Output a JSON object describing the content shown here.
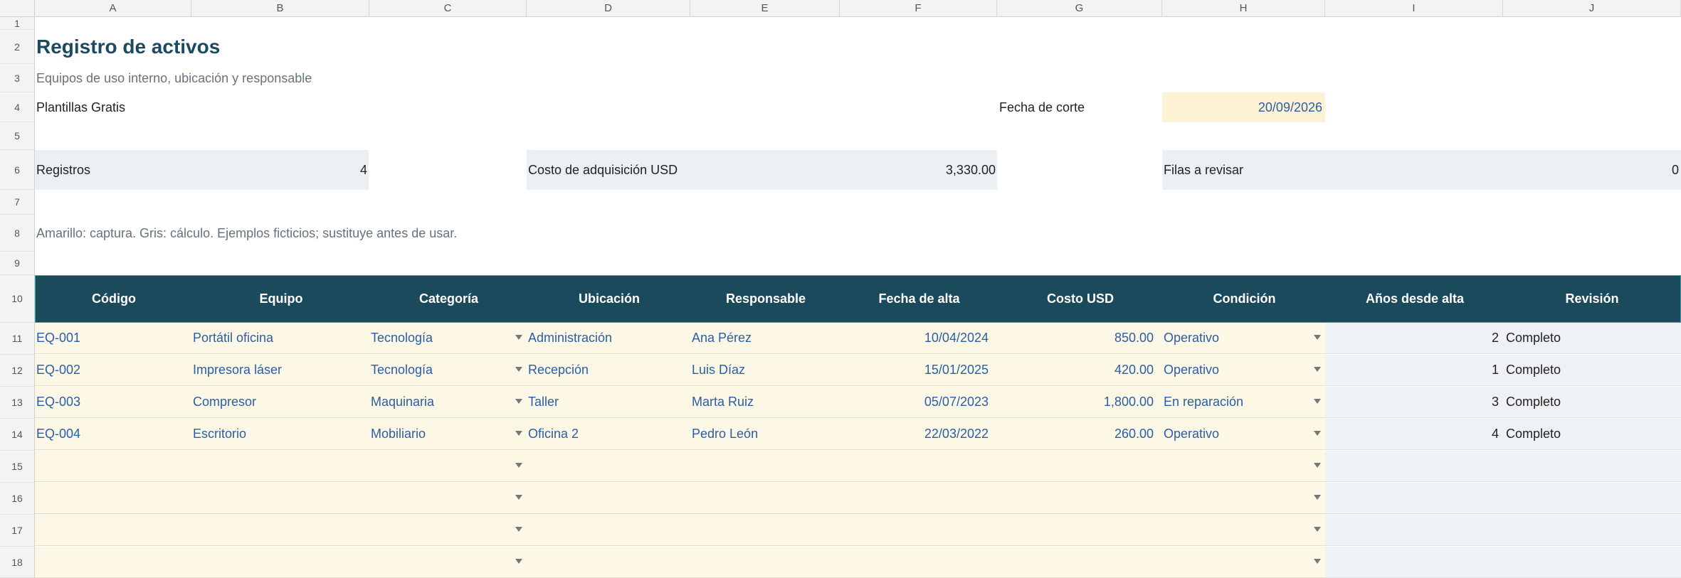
{
  "columns": [
    "A",
    "B",
    "C",
    "D",
    "E",
    "F",
    "G",
    "H",
    "I",
    "J"
  ],
  "row_numbers": [
    "1",
    "2",
    "3",
    "4",
    "5",
    "6",
    "7",
    "8",
    "9",
    "10",
    "11",
    "12",
    "13",
    "14",
    "15",
    "16",
    "17",
    "18"
  ],
  "title": "Registro de activos",
  "subtitle": "Equipos de uso interno, ubicación y responsable",
  "brand": "Plantillas Gratis",
  "cutoff_label": "Fecha de corte",
  "cutoff_date": "20/09/2026",
  "kpis": {
    "records_label": "Registros",
    "records_value": "4",
    "cost_label": "Costo de adquisición USD",
    "cost_value": "3,330.00",
    "review_label": "Filas a revisar",
    "review_value": "0"
  },
  "note": "Amarillo: captura. Gris: cálculo. Ejemplos ficticios; sustituye antes de usar.",
  "table_headers": [
    "Código",
    "Equipo",
    "Categoría",
    "Ubicación",
    "Responsable",
    "Fecha de alta",
    "Costo USD",
    "Condición",
    "Años desde alta",
    "Revisión"
  ],
  "table_rows": [
    [
      "EQ-001",
      "Portátil oficina",
      "Tecnología",
      "Administración",
      "Ana Pérez",
      "10/04/2024",
      "850.00",
      "Operativo",
      "2",
      "Completo"
    ],
    [
      "EQ-002",
      "Impresora láser",
      "Tecnología",
      "Recepción",
      "Luis Díaz",
      "15/01/2025",
      "420.00",
      "Operativo",
      "1",
      "Completo"
    ],
    [
      "EQ-003",
      "Compresor",
      "Maquinaria",
      "Taller",
      "Marta Ruiz",
      "05/07/2023",
      "1,800.00",
      "En reparación",
      "3",
      "Completo"
    ],
    [
      "EQ-004",
      "Escritorio",
      "Mobiliario",
      "Oficina 2",
      "Pedro León",
      "22/03/2022",
      "260.00",
      "Operativo",
      "4",
      "Completo"
    ],
    [
      "",
      "",
      "",
      "",
      "",
      "",
      "",
      "",
      "",
      ""
    ],
    [
      "",
      "",
      "",
      "",
      "",
      "",
      "",
      "",
      "",
      ""
    ],
    [
      "",
      "",
      "",
      "",
      "",
      "",
      "",
      "",
      "",
      ""
    ],
    [
      "",
      "",
      "",
      "",
      "",
      "",
      "",
      "",
      "",
      ""
    ]
  ],
  "colors": {
    "header_bg": "#1b4a5c",
    "input_bg": "#fdf7e6",
    "calc_bg": "#eef2f4",
    "input_text": "#2a5ea6",
    "title_text": "#1d4a5e"
  }
}
